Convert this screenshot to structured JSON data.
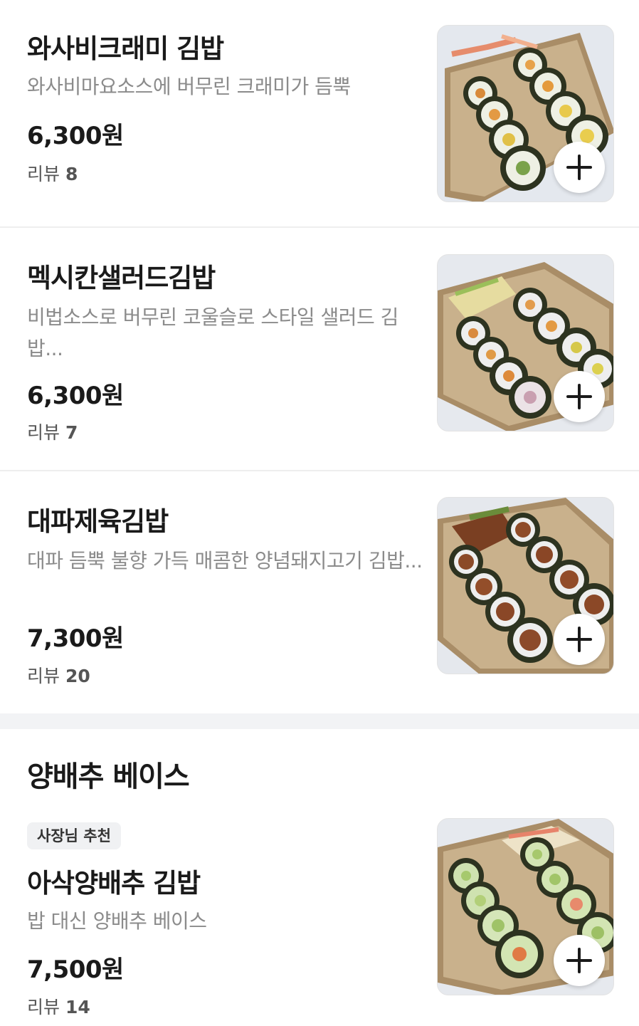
{
  "items": [
    {
      "name": "와사비크래미 김밥",
      "description": "와사비마요소스에 버무린 크래미가 듬뿍",
      "price": "6,300원",
      "review_label": "리뷰",
      "review_count": "8",
      "image": "wasabi-crab-gimbap-photo"
    },
    {
      "name": "멕시칸샐러드김밥",
      "description": "비법소스로 버무린 코울슬로 스타일 샐러드 김밥...",
      "price": "6,300원",
      "review_label": "리뷰",
      "review_count": "7",
      "image": "mexican-salad-gimbap-photo"
    },
    {
      "name": "대파제육김밥",
      "description": "대파 듬뿍 불향 가득 매콤한 양념돼지고기 김밥...",
      "price": "7,300원",
      "review_label": "리뷰",
      "review_count": "20",
      "image": "green-onion-pork-gimbap-photo"
    }
  ],
  "section": {
    "title": "양배추 베이스",
    "items": [
      {
        "badge": "사장님 추천",
        "name": "아삭양배추 김밥",
        "description": "밥 대신 양배추 베이스",
        "price": "7,500원",
        "review_label": "리뷰",
        "review_count": "14",
        "image": "crunchy-cabbage-gimbap-photo"
      }
    ]
  },
  "icons": {
    "add": "plus-icon"
  }
}
